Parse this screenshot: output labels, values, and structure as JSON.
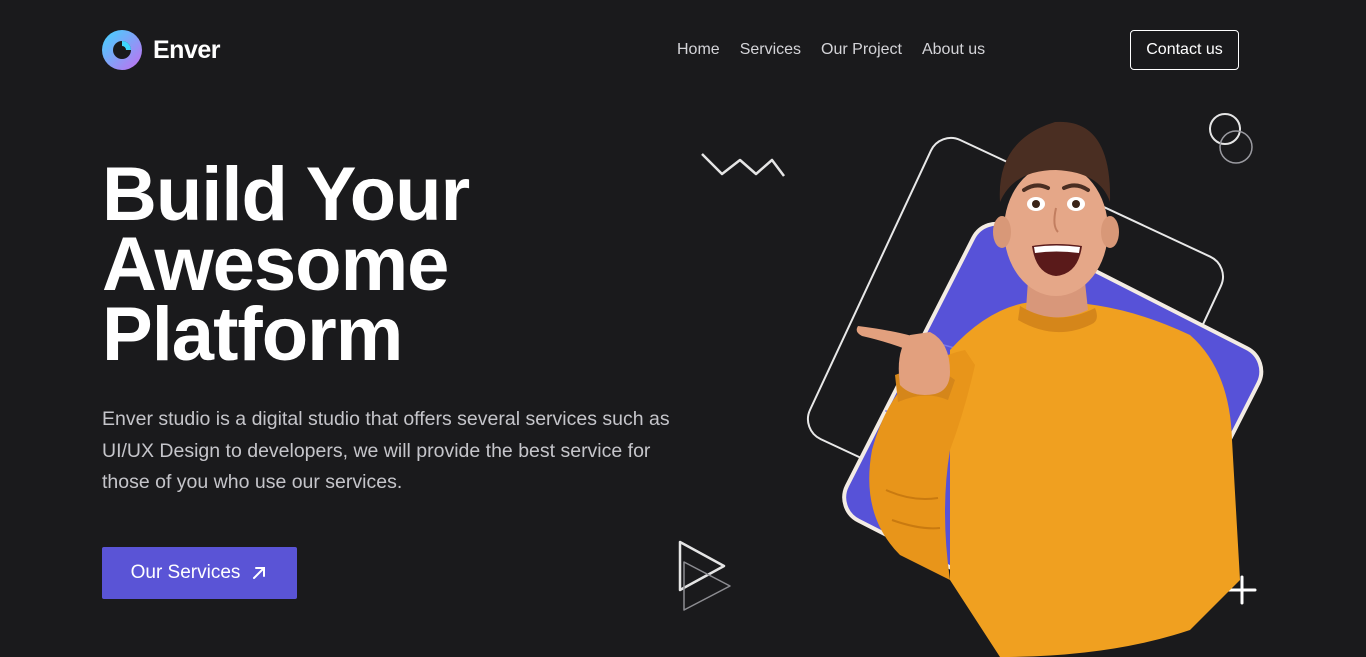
{
  "brand": {
    "name": "Enver",
    "colors": {
      "gradient_start": "#3fd6ff",
      "gradient_end": "#c56cf0"
    }
  },
  "nav": {
    "items": [
      "Home",
      "Services",
      "Our Project",
      "About us"
    ]
  },
  "header": {
    "contact_label": "Contact us"
  },
  "hero": {
    "title_lines": [
      "Build Your",
      "Awesome",
      "Platform"
    ],
    "description": "Enver studio is a digital studio that offers several services such as UI/UX Design to developers, we will provide the best service for those of you who use our services.",
    "cta_label": "Our Services",
    "cta_icon": "arrow-up-right-icon"
  },
  "colors": {
    "background": "#1a1a1c",
    "accent": "#5a54d6",
    "sweater": "#f0a020"
  },
  "decorations": [
    "zigzag-icon",
    "circles-icon",
    "play-triangles-icon",
    "plus-icon"
  ]
}
